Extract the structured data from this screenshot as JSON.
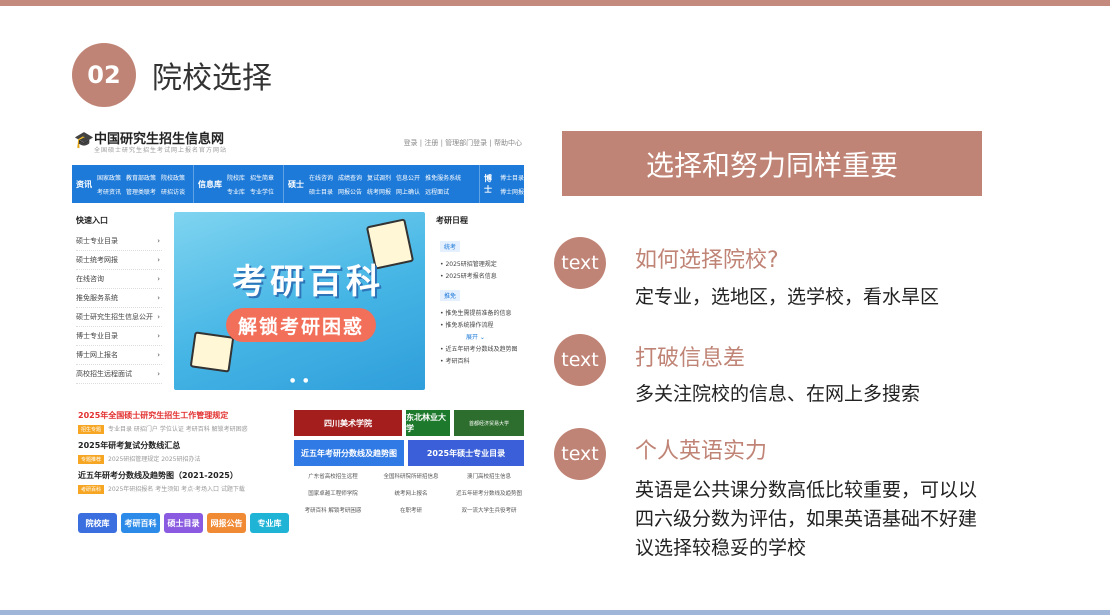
{
  "slide": {
    "number": "02",
    "title": "院校选择",
    "banner": "选择和努力同样重要",
    "points": [
      {
        "icon_text": "text",
        "heading": "如何选择院校?",
        "body": "定专业，选地区，选学校，看水旱区"
      },
      {
        "icon_text": "text",
        "heading": "打破信息差",
        "body": "多关注院校的信息、在网上多搜索"
      },
      {
        "icon_text": "text",
        "heading": "个人英语实力",
        "body": "英语是公共课分数高低比较重要，可以以四六级分数为评估，如果英语基础不好建议选择较稳妥的学校"
      }
    ],
    "colors": {
      "accent": "#c08476",
      "top_bar": "#c38a7d",
      "bottom_bar": "#9fb6d8"
    }
  },
  "site": {
    "logo_title": "中国研究生招生信息网",
    "logo_sub": "全国硕士研究生招生考试网上报名官方网站",
    "top_links": "登录 | 注册 | 管理部门登录 | 帮助中心",
    "nav": [
      {
        "head": "资讯",
        "links": [
          "国家政策",
          "教育部政策",
          "院校政策",
          "考研资讯",
          "管理类联考",
          "研招访谈"
        ]
      },
      {
        "head": "信息库",
        "links": [
          "院校库",
          "招生简章",
          "专业库",
          "专业学位"
        ]
      },
      {
        "head": "硕士",
        "links": [
          "在线咨询",
          "成绩查询",
          "复试调剂",
          "信息公开",
          "推免服务系统",
          "硕士目录",
          "网报公告",
          "统考网报",
          "网上确认",
          "远程面试"
        ]
      },
      {
        "head": "博士",
        "links": [
          "博士目录",
          "博士网报"
        ]
      }
    ],
    "quick_title": "快速入口",
    "quick_items": [
      "硕士专业目录",
      "硕士统考网报",
      "在线咨询",
      "推免服务系统",
      "硕士研究生招生信息公开",
      "博士专业目录",
      "博士网上报名",
      "高校招生远程面试"
    ],
    "banner_title": "考研百科",
    "banner_subtitle": "解锁考研困惑",
    "schedule_title": "考研日程",
    "schedule": [
      {
        "tag": "统考",
        "items": [
          "2025研招管理规定",
          "2025研考报名信息"
        ]
      },
      {
        "tag": "推免",
        "items": [
          "推免生需提前准备的信息",
          "推免系统操作流程"
        ]
      }
    ],
    "schedule_more": "展开",
    "schedule_extra": [
      "近五年研考分数线及趋势图",
      "考研百科"
    ],
    "news": [
      {
        "title": "2025年全国硕士研究生招生工作管理规定",
        "badge": "招生专题",
        "meta": "专业目录  研招门户  学位认证  考研百科  解锁考研困惑",
        "red": true
      },
      {
        "title": "2025年研考复试分数线汇总",
        "badge": "专题推荐",
        "meta": "2025研招管理规定   2025研招办法",
        "red": false
      },
      {
        "title": "近五年研考分数线及趋势图（2021-2025）",
        "badge": "考研百科",
        "meta": "2025年研招报名  考生须知  考点·考场入口  试题下载",
        "red": false
      }
    ],
    "buttons": [
      {
        "label": "院校库",
        "color": "#3b6fe0"
      },
      {
        "label": "考研百科",
        "color": "#2c8be8"
      },
      {
        "label": "硕士目录",
        "color": "#8a5be0"
      },
      {
        "label": "网报公告",
        "color": "#f08a35"
      },
      {
        "label": "专业库",
        "color": "#1fb3d6"
      }
    ],
    "ads": {
      "ad1": "四川美术学院",
      "ad2": "东北林业大学",
      "ad3": "首都经济贸易大学",
      "ad4": "近五年考研分数线及趋势图",
      "ad5": "2025年硕士专业目录"
    },
    "bottom_links": [
      "广东省高校招生远程",
      "全国科研院所研招信息",
      "澳门高校招生信息",
      "国家卓越工程师学院",
      "统考网上报名",
      "近五年研考分数线及趋势图",
      "考研百科 解锁考研困惑",
      "在职考研",
      "双一流大学生兵役考研"
    ]
  }
}
